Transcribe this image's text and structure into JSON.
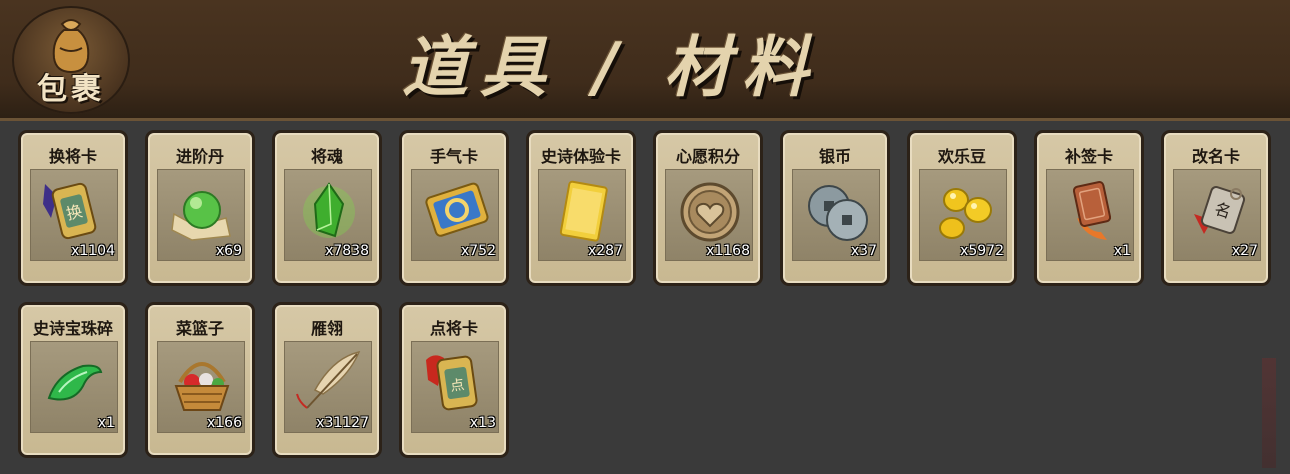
{
  "header": {
    "bag_label": "包裹",
    "title": "道具 / 材料"
  },
  "items": [
    {
      "name": "换将卡",
      "count": "x1104",
      "icon": "swap-general-card-icon"
    },
    {
      "name": "进阶丹",
      "count": "x69",
      "icon": "advance-pill-icon"
    },
    {
      "name": "将魂",
      "count": "x7838",
      "icon": "general-soul-crystal-icon"
    },
    {
      "name": "手气卡",
      "count": "x752",
      "icon": "luck-card-icon"
    },
    {
      "name": "史诗体验卡",
      "count": "x287",
      "icon": "epic-trial-card-icon"
    },
    {
      "name": "心愿积分",
      "count": "x1168",
      "icon": "wish-points-coin-icon"
    },
    {
      "name": "银币",
      "count": "x37",
      "icon": "silver-coin-icon"
    },
    {
      "name": "欢乐豆",
      "count": "x5972",
      "icon": "happy-beans-icon"
    },
    {
      "name": "补签卡",
      "count": "x1",
      "icon": "makeup-sign-card-icon"
    },
    {
      "name": "改名卡",
      "count": "x27",
      "icon": "rename-card-icon"
    },
    {
      "name": "史诗宝珠碎",
      "count": "x1",
      "icon": "epic-gem-shard-icon"
    },
    {
      "name": "菜篮子",
      "count": "x166",
      "icon": "vegetable-basket-icon"
    },
    {
      "name": "雁翎",
      "count": "x31127",
      "icon": "goose-feather-icon"
    },
    {
      "name": "点将卡",
      "count": "x13",
      "icon": "appoint-general-card-icon"
    }
  ]
}
